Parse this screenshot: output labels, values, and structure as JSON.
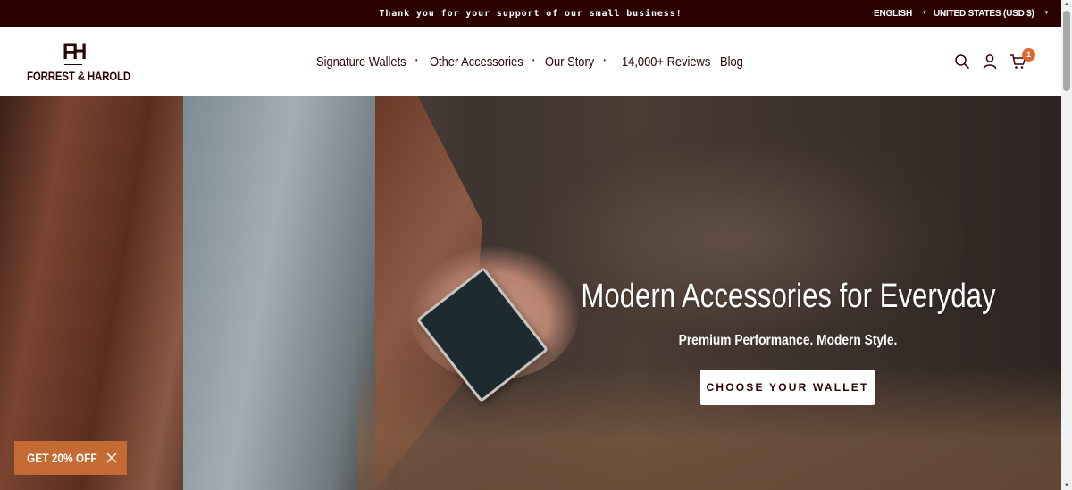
{
  "announcement": {
    "text": "Thank you for your support of our small business!",
    "language": "ENGLISH",
    "currency": "UNITED STATES (USD $)",
    "caret_glyph": "▾"
  },
  "brand": {
    "monogram": "FH",
    "name": "FORREST & HAROLD",
    "color": "#2b0303"
  },
  "nav": {
    "items": [
      {
        "label": "Signature Wallets",
        "has_dropdown": true
      },
      {
        "label": "Other Accessories",
        "has_dropdown": true
      },
      {
        "label": "Our Story",
        "has_dropdown": true
      },
      {
        "label": "14,000+ Reviews",
        "has_dropdown": false
      },
      {
        "label": "Blog",
        "has_dropdown": false
      }
    ],
    "dropdown_glyph": "•"
  },
  "header_icons": {
    "search": "search-icon",
    "account": "user-icon",
    "cart": "cart-icon",
    "cart_count": "1",
    "badge_color": "#e0672c"
  },
  "hero": {
    "title": "Modern Accessories for Everyday",
    "subtitle": "Premium Performance. Modern Style.",
    "cta_label": "CHOOSE YOUR WALLET"
  },
  "discount": {
    "label": "GET 20% OFF",
    "color": "#c46a33"
  },
  "scrollbar": {
    "up_glyph": "▲",
    "down_glyph": "▼"
  }
}
